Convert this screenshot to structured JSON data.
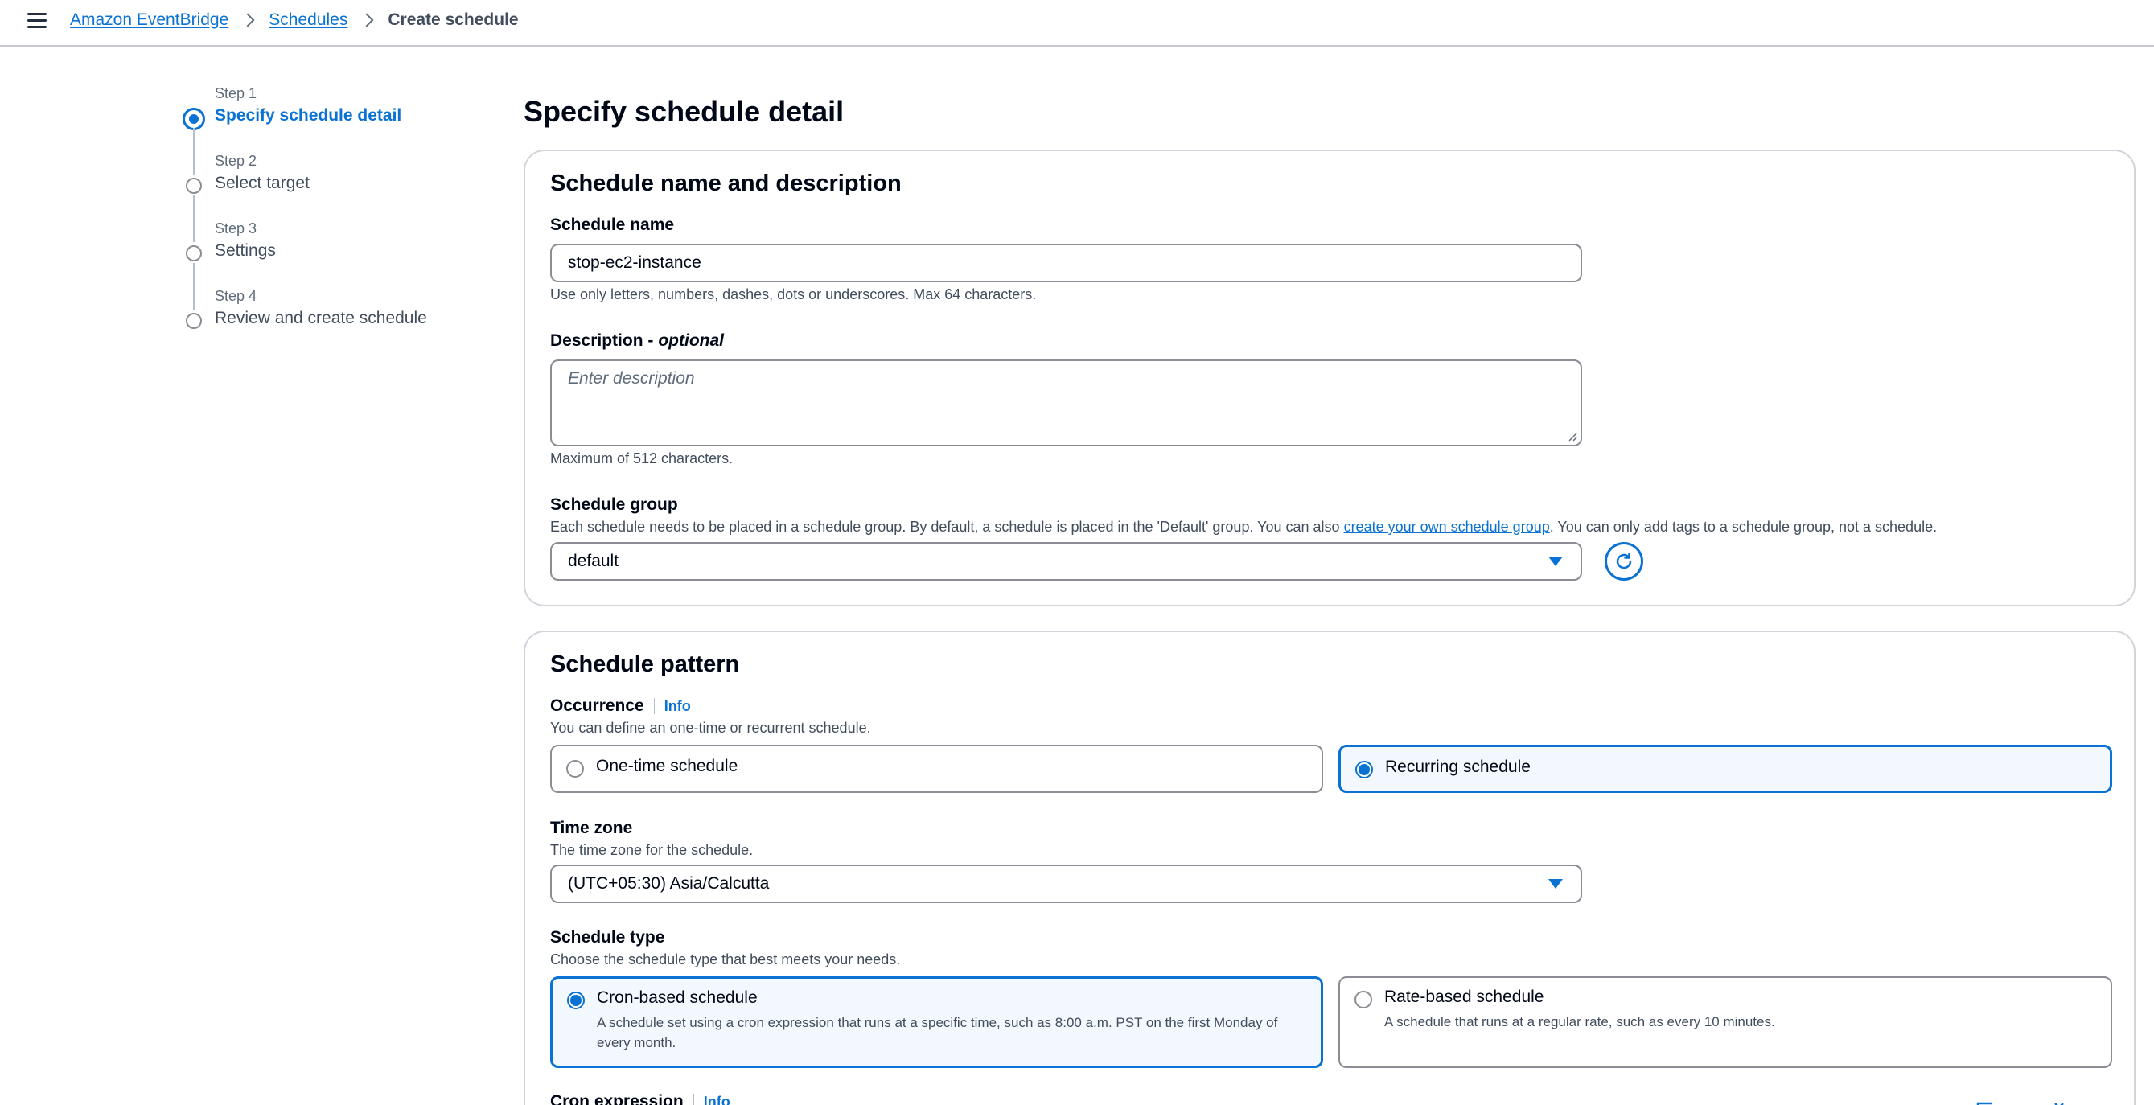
{
  "breadcrumb": {
    "items": [
      "Amazon EventBridge",
      "Schedules"
    ],
    "current": "Create schedule"
  },
  "steps": [
    {
      "label": "Step 1",
      "title": "Specify schedule detail",
      "active": true
    },
    {
      "label": "Step 2",
      "title": "Select target",
      "active": false
    },
    {
      "label": "Step 3",
      "title": "Settings",
      "active": false
    },
    {
      "label": "Step 4",
      "title": "Review and create schedule",
      "active": false
    }
  ],
  "page_title": "Specify schedule detail",
  "name_section": {
    "header": "Schedule name and description",
    "name_label": "Schedule name",
    "name_value": "stop-ec2-instance",
    "name_hint": "Use only letters, numbers, dashes, dots or underscores. Max 64 characters.",
    "description_label": "Description - ",
    "description_optional": "optional",
    "description_placeholder": "Enter description",
    "description_hint": "Maximum of 512 characters.",
    "group_label": "Schedule group",
    "group_hint_before": "Each schedule needs to be placed in a schedule group. By default, a schedule is placed in the 'Default' group. You can also ",
    "group_hint_link": "create your own schedule group",
    "group_hint_after": ". You can only add tags to a schedule group, not a schedule.",
    "group_value": "default"
  },
  "pattern_section": {
    "header": "Schedule pattern",
    "occurrence_label": "Occurrence",
    "info": "Info",
    "occurrence_hint": "You can define an one-time or recurrent schedule.",
    "one_time": "One-time schedule",
    "recurring": "Recurring schedule",
    "timezone_label": "Time zone",
    "timezone_hint": "The time zone for the schedule.",
    "timezone_value": "(UTC+05:30) Asia/Calcutta",
    "type_label": "Schedule type",
    "type_hint": "Choose the schedule type that best meets your needs.",
    "cron_title": "Cron-based schedule",
    "cron_desc": "A schedule set using a cron expression that runs at a specific time, such as 8:00 a.m. PST on the first Monday of every month.",
    "rate_title": "Rate-based schedule",
    "rate_desc": "A schedule that runs at a regular rate, such as every 10 minutes.",
    "cron_expression_label": "Cron expression"
  },
  "colors": {
    "accent": "#0972d3",
    "selected_bg": "#f2f8fd",
    "border": "#8c8c94"
  }
}
